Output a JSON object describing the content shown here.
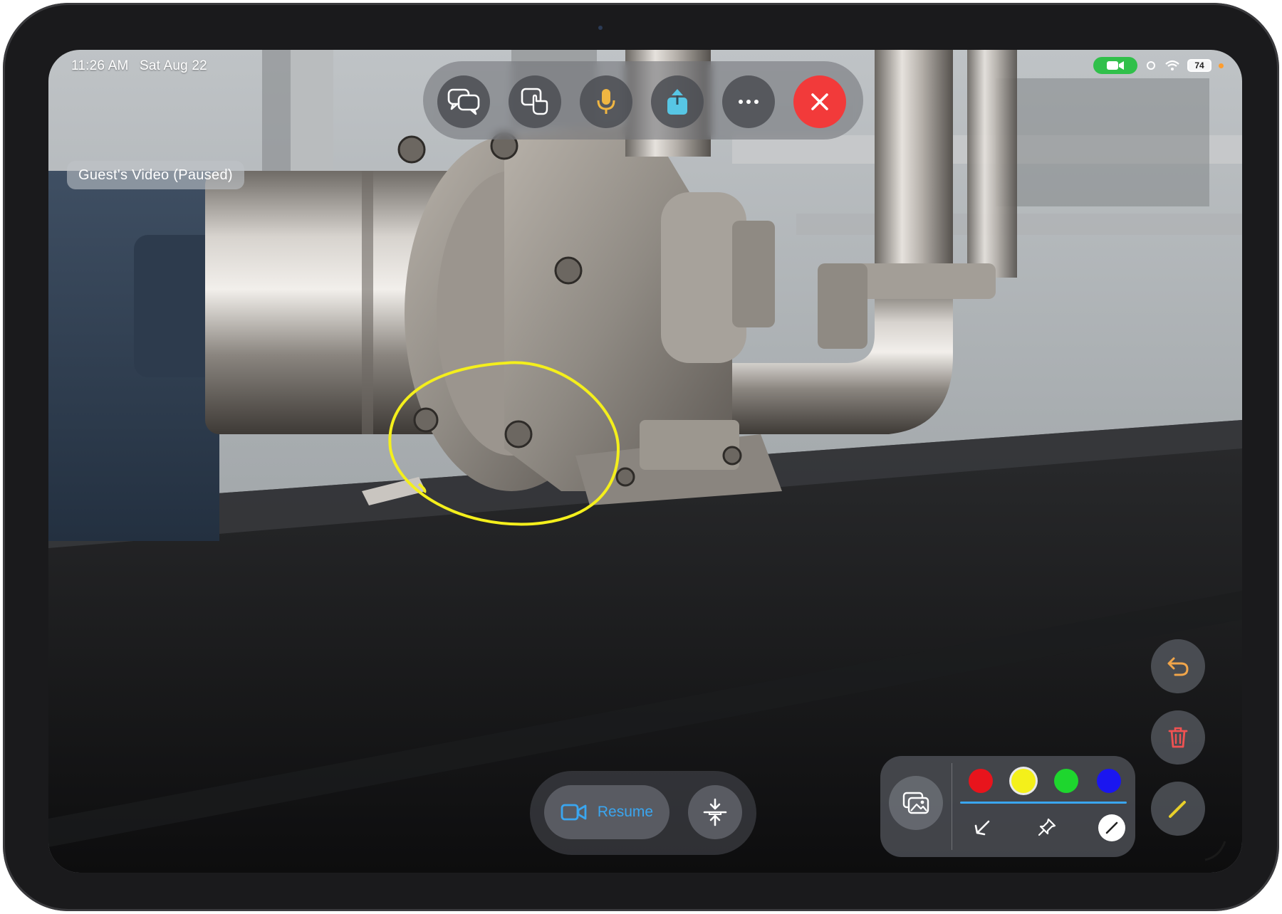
{
  "status_bar": {
    "time": "11:26 AM",
    "date": "Sat Aug 22",
    "battery": "74"
  },
  "video": {
    "label": "Guest's Video (Paused)",
    "annotation_color": "#f4ef1c"
  },
  "top_toolbar": {
    "buttons": [
      {
        "name": "chat",
        "icon": "chat-bubbles-icon"
      },
      {
        "name": "remote-control",
        "icon": "hand-pointer-icon"
      },
      {
        "name": "mute",
        "icon": "microphone-icon",
        "color": "#f0b642"
      },
      {
        "name": "share",
        "icon": "share-icon",
        "color": "#57c6e4"
      },
      {
        "name": "more",
        "icon": "ellipsis-icon"
      },
      {
        "name": "end-call",
        "icon": "close-icon",
        "color": "#f23a3a"
      }
    ]
  },
  "bottom_bar": {
    "resume_label": "Resume",
    "resume_icon": "video-camera-icon",
    "freeze_icon": "freeze-frame-icon"
  },
  "side_actions": [
    {
      "name": "undo",
      "icon": "undo-icon",
      "color": "#f0a54a"
    },
    {
      "name": "delete",
      "icon": "trash-icon",
      "color": "#f05252"
    },
    {
      "name": "pen",
      "icon": "pencil-icon",
      "color": "#e8d02a"
    }
  ],
  "draw_panel": {
    "colors": [
      {
        "name": "red",
        "hex": "#e8141c"
      },
      {
        "name": "yellow",
        "hex": "#f4f01a",
        "selected": true
      },
      {
        "name": "green",
        "hex": "#1ed62e"
      },
      {
        "name": "blue",
        "hex": "#1a16f0"
      }
    ],
    "tools": [
      {
        "name": "arrow",
        "icon": "arrow-icon"
      },
      {
        "name": "pin",
        "icon": "pin-icon"
      },
      {
        "name": "freehand",
        "icon": "freehand-icon",
        "active": true
      }
    ]
  }
}
